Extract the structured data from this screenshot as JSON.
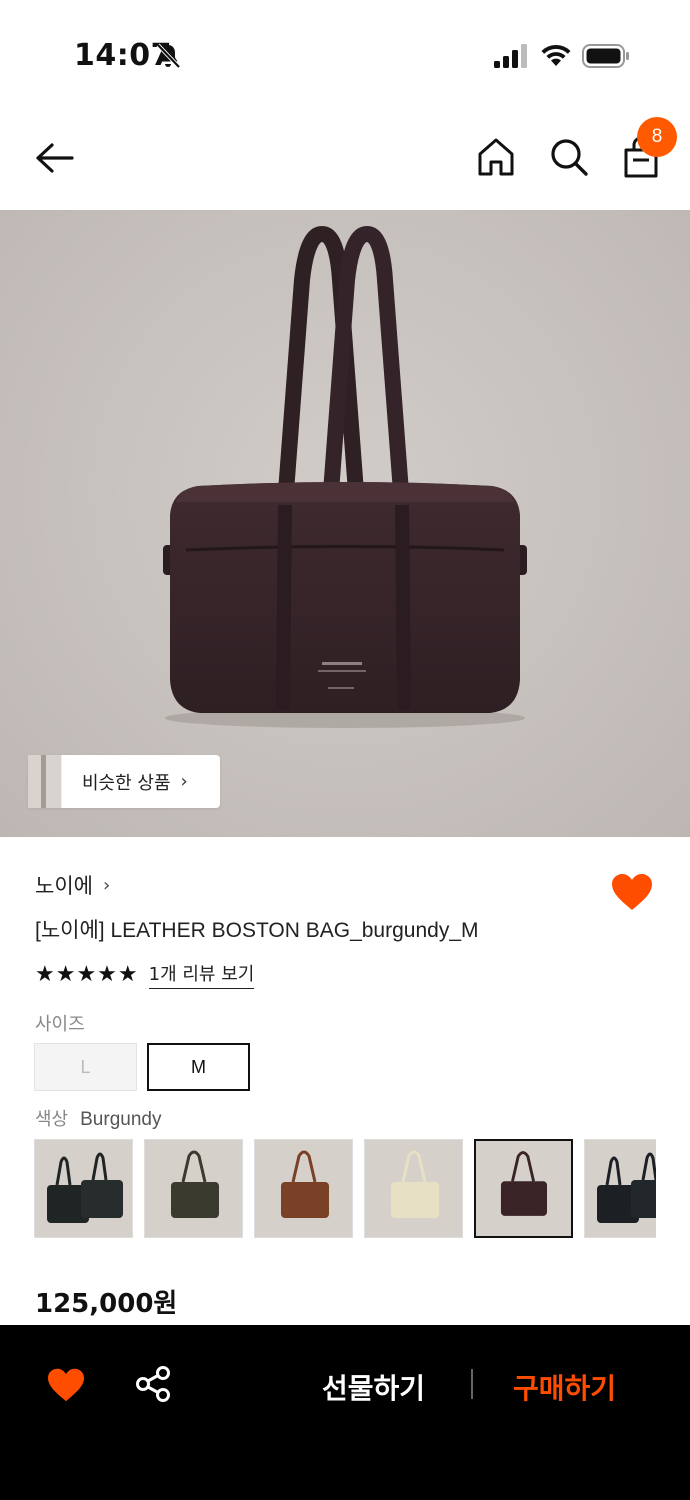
{
  "status": {
    "time": "14:07"
  },
  "nav": {
    "cart_count": "8"
  },
  "hero": {
    "similar_label": "비슷한 상품",
    "similar_chevron": "›"
  },
  "product": {
    "brand": "노이에",
    "brand_chevron": "›",
    "name": "[노이에] LEATHER BOSTON BAG_burgundy_M",
    "stars": "★★★★★",
    "rating": 5,
    "review_link": "1개 리뷰 보기",
    "size_label": "사이즈",
    "sizes": [
      "L",
      "M"
    ],
    "selected_size": "M",
    "color_label": "색상",
    "color_value": "Burgundy",
    "color_options": [
      {
        "color": "#1f2524"
      },
      {
        "color": "#3a3a2e"
      },
      {
        "color": "#7a4126"
      },
      {
        "color": "#e8e0c4"
      },
      {
        "color": "#3a2326",
        "selected": true
      },
      {
        "color": "#1c2024"
      }
    ],
    "price": "125,000원"
  },
  "bottom": {
    "gift_label": "선물하기",
    "buy_label": "구매하기"
  },
  "colors": {
    "accent": "#ff5a00",
    "heart": "#ff4d00",
    "buy": "#ff4d00"
  },
  "icons": [
    "bell-slash-icon",
    "signal-icon",
    "wifi-icon",
    "battery-icon",
    "back-arrow-icon",
    "home-icon",
    "search-icon",
    "cart-icon",
    "heart-icon",
    "share-icon",
    "chevron-right-icon"
  ]
}
